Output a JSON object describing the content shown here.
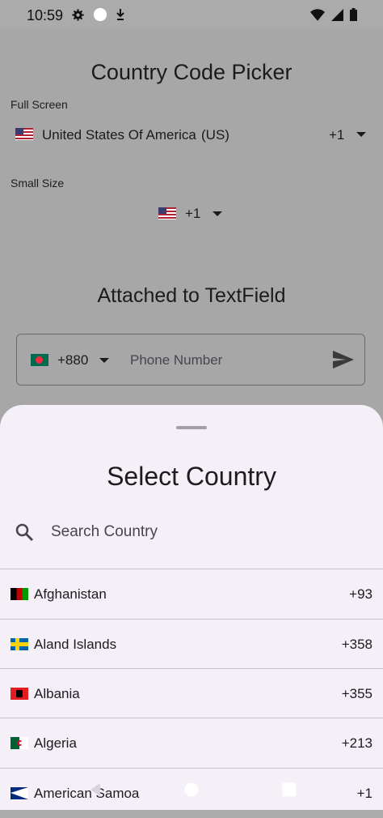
{
  "status": {
    "time": "10:59"
  },
  "main": {
    "title": "Country Code Picker",
    "full_label": "Full Screen",
    "full_country": "United States Of America",
    "full_iso": "(US)",
    "full_code": "+1",
    "small_label": "Small Size",
    "small_code": "+1",
    "attached_title": "Attached to TextField",
    "tf_code": "+880",
    "tf_placeholder": "Phone Number"
  },
  "sheet": {
    "title": "Select Country",
    "search_placeholder": "Search Country",
    "countries": [
      {
        "name": "Afghanistan",
        "code": "+93",
        "flag": "af"
      },
      {
        "name": "Aland Islands",
        "code": "+358",
        "flag": "ax"
      },
      {
        "name": "Albania",
        "code": "+355",
        "flag": "al"
      },
      {
        "name": "Algeria",
        "code": "+213",
        "flag": "dz"
      },
      {
        "name": "American Samoa",
        "code": "+1",
        "flag": "as"
      }
    ]
  },
  "icons": [
    "settings-icon",
    "circle-icon",
    "download-icon",
    "wifi-icon",
    "signal-icon",
    "battery-icon",
    "caret-down-icon",
    "send-icon",
    "search-icon",
    "back-icon",
    "home-icon",
    "recents-icon"
  ]
}
